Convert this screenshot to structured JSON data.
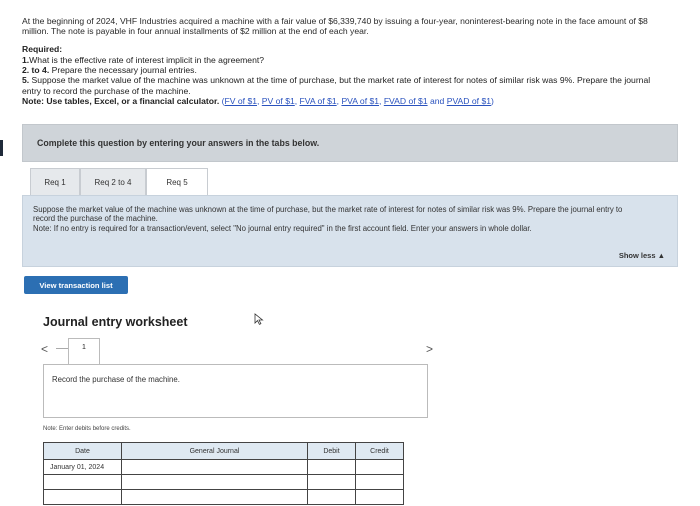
{
  "problem": {
    "intro": "At the beginning of 2024, VHF Industries acquired a machine with a fair value of $6,339,740 by issuing a four-year, noninterest-bearing note in the face amount of $8 million. The note is payable in four annual installments of $2 million at the end of each year.",
    "required_label": "Required:",
    "req1_num": "1.",
    "req1_text": "What is the effective rate of interest implicit in the agreement?",
    "req2_num": "2. to 4.",
    "req2_text": " Prepare the necessary journal entries.",
    "req5_num": "5.",
    "req5_text": " Suppose the market value of the machine was unknown at the time of purchase, but the market rate of interest for notes of similar risk was 9%. Prepare the journal entry to record the purchase of the machine.",
    "note_label": "Note: Use tables, Excel, or a financial calculator.",
    "links": {
      "open": "(",
      "fv": "FV of $1",
      "pv": "PV of $1",
      "fva": "FVA of $1",
      "pva": "PVA of $1",
      "fvad": "FVAD of $1",
      "and": " and ",
      "pvad": "PVAD of $1",
      "close": ")",
      "sep": ", "
    }
  },
  "banner": {
    "text": "Complete this question by entering your answers in the tabs below."
  },
  "tabs": [
    {
      "label": "Req 1"
    },
    {
      "label": "Req 2 to 4"
    },
    {
      "label": "Req 5"
    }
  ],
  "panel": {
    "line1": "Suppose the market value of the machine was unknown at the time of purchase, but the market rate of interest for notes of similar risk was 9%. Prepare the journal entry to record the purchase of the machine.",
    "line2": "Note: If no entry is required for a transaction/event, select \"No journal entry required\" in the first account field. Enter your answers in whole dollar.",
    "show_less": "Show less ▲"
  },
  "view_transaction_list": "View transaction list",
  "worksheet": {
    "title": "Journal entry worksheet",
    "prev": "<",
    "next": ">",
    "page": "1",
    "instruction": "Record the purchase of the machine.",
    "note": "Note: Enter debits before credits.",
    "columns": [
      "Date",
      "General Journal",
      "Debit",
      "Credit"
    ],
    "rows": [
      [
        "January 01, 2024",
        "",
        "",
        ""
      ],
      [
        "",
        "",
        "",
        ""
      ],
      [
        "",
        "",
        "",
        ""
      ]
    ]
  }
}
